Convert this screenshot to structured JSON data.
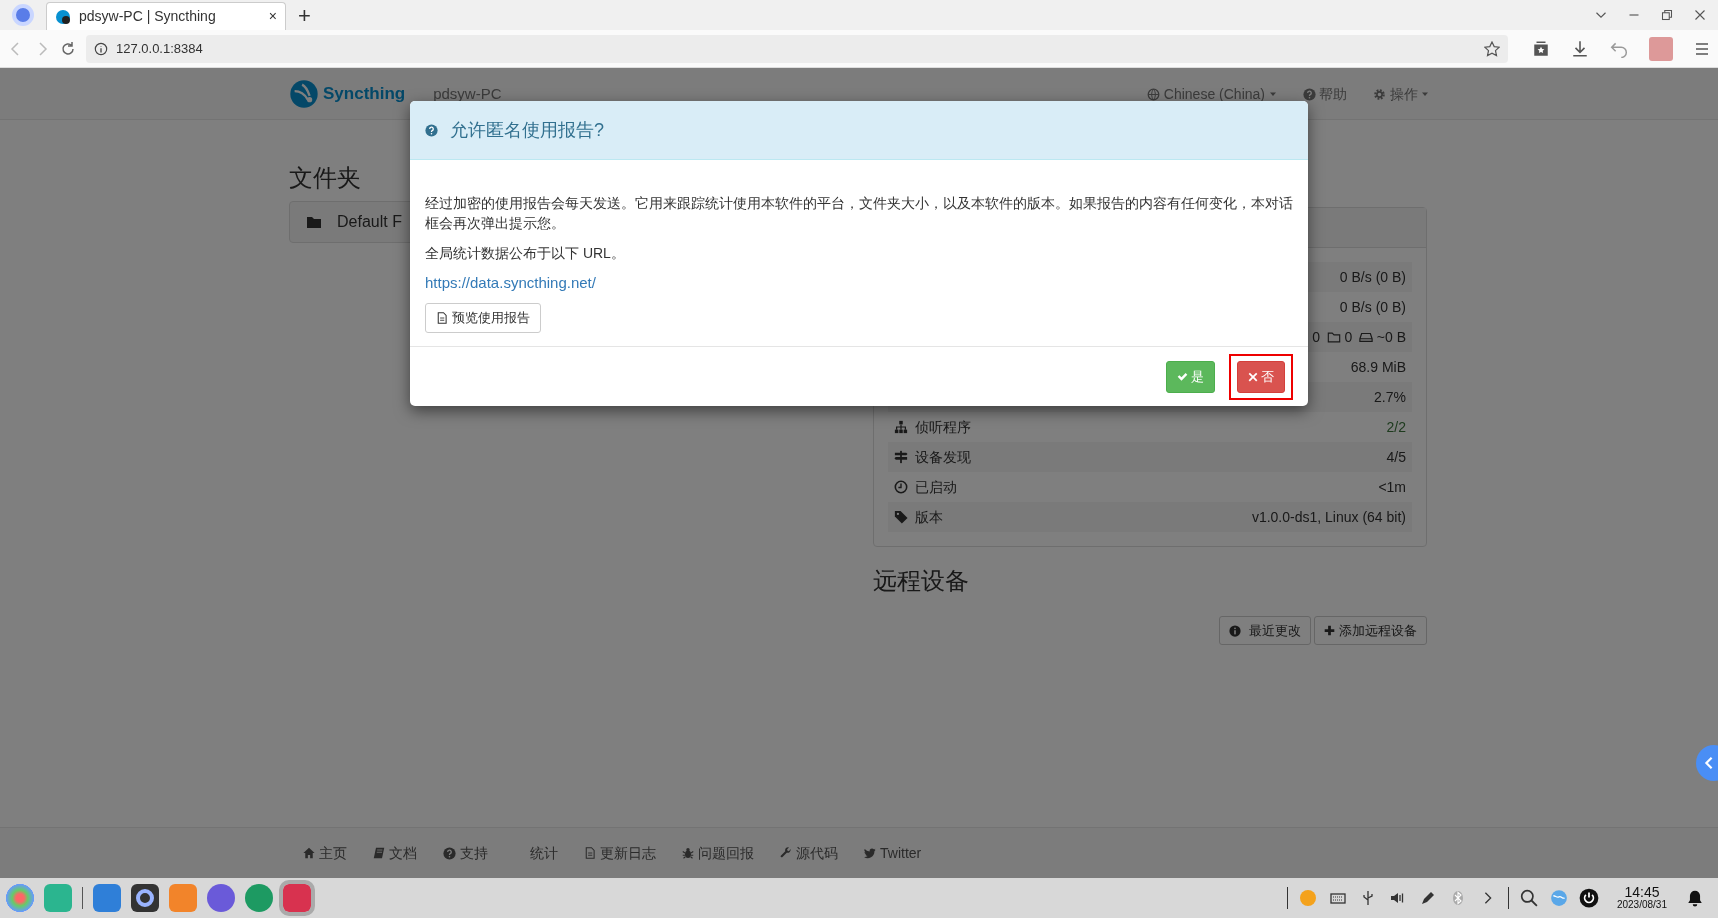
{
  "browser": {
    "tab_title": "pdsyw-PC | Syncthing",
    "tab_close": "×",
    "new_tab": "+",
    "url": "127.0.0.1:8384"
  },
  "navbar": {
    "brand": "Syncthing",
    "device_name": "pdsyw-PC",
    "menus": [
      {
        "label": "Chinese (China)",
        "kind": "language",
        "caret": true
      },
      {
        "label": "帮助",
        "kind": "help",
        "caret": false
      },
      {
        "label": "操作",
        "kind": "actions",
        "caret": true
      }
    ]
  },
  "folders": {
    "heading": "文件夹",
    "items": [
      {
        "name": "Default F"
      }
    ]
  },
  "this_device": {
    "stats": [
      {
        "kind": "plain",
        "value": "0 B/s (0 B)"
      },
      {
        "kind": "plain",
        "value": "0 B/s (0 B)"
      },
      {
        "kind": "counts",
        "files": "0",
        "dirs": "0",
        "size": "~0 B"
      },
      {
        "kind": "plain",
        "value": "68.9 MiB"
      },
      {
        "kind": "plain",
        "value": "2.7%"
      },
      {
        "kind": "listeners",
        "label": "侦听程序",
        "value": "2/2",
        "healthy": true
      },
      {
        "kind": "discovery",
        "label": "设备发现",
        "value": "4/5",
        "healthy": false
      },
      {
        "kind": "uptime",
        "label": "已启动",
        "value": "<1m"
      },
      {
        "kind": "version",
        "label": "版本",
        "value": "v1.0.0-ds1, Linux (64 bit)"
      }
    ]
  },
  "remote_devices": {
    "heading": "远程设备",
    "buttons": [
      {
        "label": "最近更改",
        "kind": "info"
      },
      {
        "label": "添加远程设备",
        "kind": "add"
      }
    ]
  },
  "footer": {
    "links": [
      {
        "label": "主页",
        "kind": "home"
      },
      {
        "label": "文档",
        "kind": "book"
      },
      {
        "label": "支持",
        "kind": "question"
      },
      {
        "label": "统计",
        "kind": "none"
      },
      {
        "label": "更新日志",
        "kind": "file"
      },
      {
        "label": "问题回报",
        "kind": "bug"
      },
      {
        "label": "源代码",
        "kind": "wrench"
      },
      {
        "label": "Twitter",
        "kind": "bird"
      }
    ]
  },
  "modal": {
    "title": "允许匿名使用报告?",
    "paragraphs": [
      "经过加密的使用报告会每天发送。它用来跟踪统计使用本软件的平台，文件夹大小，以及本软件的版本。如果报告的内容有任何变化，本对话框会再次弹出提示您。",
      "全局统计数据公布于以下 URL。"
    ],
    "link": "https://data.syncthing.net/",
    "preview_button": "预览使用报告",
    "buttons": [
      {
        "label": "是",
        "kind": "yes",
        "highlighted": false
      },
      {
        "label": "否",
        "kind": "no",
        "highlighted": true
      }
    ]
  },
  "taskbar": {
    "time": "14:45",
    "date": "2023/08/31"
  }
}
